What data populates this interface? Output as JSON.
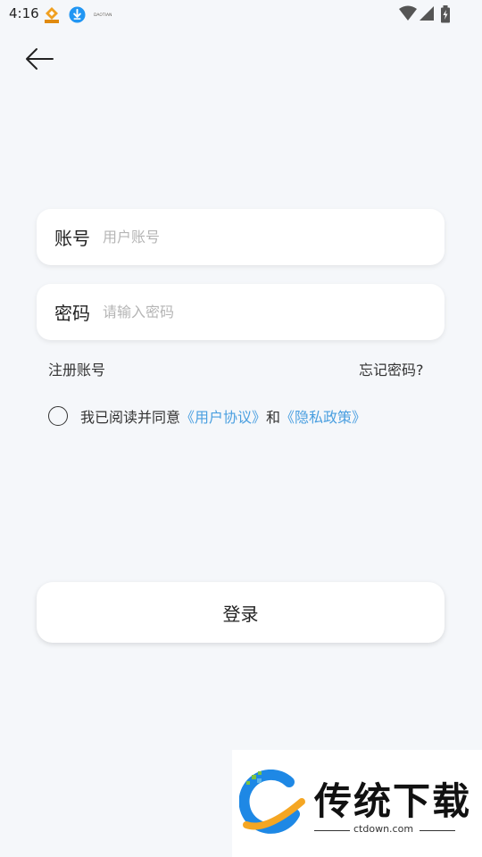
{
  "status_bar": {
    "time": "4:16",
    "notification_icons": [
      "app-badge-icon",
      "download-icon",
      "small-app-icon"
    ],
    "system_icons": [
      "wifi-icon",
      "signal-icon",
      "battery-icon"
    ]
  },
  "nav": {
    "back_icon": "arrow-left-icon"
  },
  "form": {
    "account": {
      "label": "账号",
      "placeholder": "用户账号",
      "value": ""
    },
    "password": {
      "label": "密码",
      "placeholder": "请输入密码",
      "value": ""
    },
    "register_link": "注册账号",
    "forgot_link": "忘记密码?"
  },
  "agreement": {
    "checked": false,
    "prefix": "我已阅读并同意",
    "user_agreement": "《用户协议》",
    "conjunction": "和",
    "privacy_policy": "《隐私政策》",
    "link_color": "#4a9fe0"
  },
  "login_button": {
    "label": "登录"
  },
  "watermark": {
    "title": "传统下载",
    "url": "ctdown.com"
  },
  "colors": {
    "background": "#f5f7fa",
    "card": "#ffffff",
    "link": "#4a9fe0"
  }
}
